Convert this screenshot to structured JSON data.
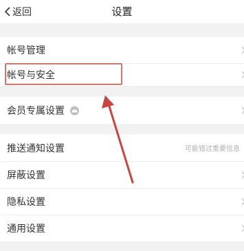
{
  "header": {
    "back_label": "返回",
    "title": "设置"
  },
  "rows": {
    "account_manage": "帐号管理",
    "account_security": "帐号与安全",
    "member_settings": "会员专属设置",
    "push_notify": "推送通知设置",
    "push_notify_hint": "可能错过重要信息",
    "block": "屏蔽设置",
    "privacy": "隐私设置",
    "general": "通用设置"
  },
  "annotation": {
    "highlight_color": "#d2766a",
    "arrow_color": "#c9453f"
  }
}
